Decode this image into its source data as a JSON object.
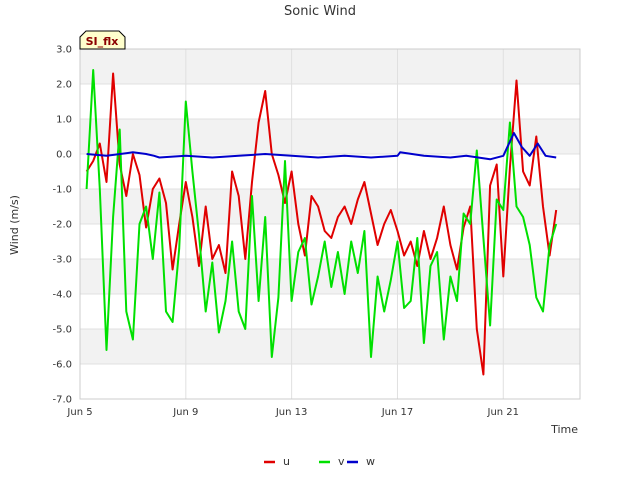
{
  "chart_data": {
    "type": "line",
    "title": "Sonic Wind",
    "badge": "SI_flx",
    "xlabel": "Time",
    "ylabel": "Wind (m/s)",
    "ylim": [
      -7,
      3
    ],
    "yticks": [
      3,
      2,
      1,
      0,
      -1,
      -2,
      -3,
      -4,
      -5,
      -6,
      -7
    ],
    "ytick_labels": [
      "3.0",
      "2.0",
      "1.0",
      "0.0",
      "-1.0",
      "-2.0",
      "-3.0",
      "-4.0",
      "-5.0",
      "-6.0",
      "-7.0"
    ],
    "xlim": [
      5.0,
      23.9
    ],
    "xticks": [
      5,
      9,
      13,
      17,
      21
    ],
    "xtick_labels": [
      "Jun 5",
      "Jun 9",
      "Jun 13",
      "Jun 17",
      "Jun 21"
    ],
    "grid": true,
    "legend_position": "bottom",
    "series": [
      {
        "name": "u",
        "color": "#e00000",
        "x": [
          5.25,
          5.5,
          5.75,
          6.0,
          6.25,
          6.5,
          6.75,
          7.0,
          7.25,
          7.5,
          7.75,
          8.0,
          8.25,
          8.5,
          8.75,
          9.0,
          9.25,
          9.5,
          9.75,
          10.0,
          10.25,
          10.5,
          10.75,
          11.0,
          11.25,
          11.5,
          11.75,
          12.0,
          12.25,
          12.5,
          12.75,
          13.0,
          13.25,
          13.5,
          13.75,
          14.0,
          14.25,
          14.5,
          14.75,
          15.0,
          15.25,
          15.5,
          15.75,
          16.0,
          16.25,
          16.5,
          16.75,
          17.0,
          17.25,
          17.5,
          17.75,
          18.0,
          18.25,
          18.5,
          18.75,
          19.0,
          19.25,
          19.5,
          19.75,
          20.0,
          20.25,
          20.5,
          20.75,
          21.0,
          21.25,
          21.5,
          21.75,
          22.0,
          22.25,
          22.5,
          22.75,
          23.0
        ],
        "y": [
          -0.5,
          -0.2,
          0.3,
          -0.8,
          2.3,
          -0.3,
          -1.2,
          0.0,
          -0.6,
          -2.1,
          -1.0,
          -0.7,
          -1.4,
          -3.3,
          -2.0,
          -0.8,
          -1.8,
          -3.2,
          -1.5,
          -3.0,
          -2.6,
          -3.4,
          -0.5,
          -1.2,
          -3.0,
          -0.8,
          0.9,
          1.8,
          0.0,
          -0.6,
          -1.4,
          -0.5,
          -2.0,
          -2.9,
          -1.2,
          -1.5,
          -2.2,
          -2.4,
          -1.8,
          -1.5,
          -2.0,
          -1.3,
          -0.8,
          -1.7,
          -2.6,
          -2.0,
          -1.6,
          -2.2,
          -2.9,
          -2.5,
          -3.2,
          -2.2,
          -3.0,
          -2.4,
          -1.5,
          -2.6,
          -3.3,
          -2.1,
          -1.5,
          -5.0,
          -6.3,
          -0.9,
          -0.3,
          -3.5,
          -0.4,
          2.1,
          -0.5,
          -0.9,
          0.5,
          -1.5,
          -2.9,
          -1.6
        ]
      },
      {
        "name": "v",
        "color": "#00e000",
        "x": [
          5.25,
          5.5,
          5.75,
          6.0,
          6.25,
          6.5,
          6.75,
          7.0,
          7.25,
          7.5,
          7.75,
          8.0,
          8.25,
          8.5,
          8.75,
          9.0,
          9.25,
          9.5,
          9.75,
          10.0,
          10.25,
          10.5,
          10.75,
          11.0,
          11.25,
          11.5,
          11.75,
          12.0,
          12.25,
          12.5,
          12.75,
          13.0,
          13.25,
          13.5,
          13.75,
          14.0,
          14.25,
          14.5,
          14.75,
          15.0,
          15.25,
          15.5,
          15.75,
          16.0,
          16.25,
          16.5,
          16.75,
          17.0,
          17.25,
          17.5,
          17.75,
          18.0,
          18.25,
          18.5,
          18.75,
          19.0,
          19.25,
          19.5,
          19.75,
          20.0,
          20.25,
          20.5,
          20.75,
          21.0,
          21.25,
          21.5,
          21.75,
          22.0,
          22.25,
          22.5,
          22.75,
          23.0
        ],
        "y": [
          -1.0,
          2.4,
          -1.0,
          -5.6,
          -1.8,
          0.7,
          -4.5,
          -5.3,
          -2.0,
          -1.5,
          -3.0,
          -1.1,
          -4.5,
          -4.8,
          -2.7,
          1.5,
          -0.5,
          -2.3,
          -4.5,
          -3.1,
          -5.1,
          -4.2,
          -2.5,
          -4.5,
          -5.0,
          -1.2,
          -4.2,
          -1.8,
          -5.8,
          -4.1,
          -0.2,
          -4.2,
          -2.8,
          -2.4,
          -4.3,
          -3.5,
          -2.5,
          -3.8,
          -2.8,
          -4.0,
          -2.5,
          -3.4,
          -2.2,
          -5.8,
          -3.5,
          -4.5,
          -3.6,
          -2.5,
          -4.4,
          -4.2,
          -2.4,
          -5.4,
          -3.2,
          -2.8,
          -5.3,
          -3.5,
          -4.2,
          -1.7,
          -2.0,
          0.1,
          -2.4,
          -4.9,
          -1.3,
          -1.6,
          0.9,
          -1.5,
          -1.8,
          -2.6,
          -4.1,
          -4.5,
          -2.6,
          -2.0
        ]
      },
      {
        "name": "w",
        "color": "#0000cc",
        "x": [
          5.25,
          6.0,
          7.0,
          7.5,
          7.8,
          8.0,
          9.0,
          10.0,
          11.0,
          12.0,
          13.0,
          14.0,
          15.0,
          16.0,
          17.0,
          17.1,
          18.0,
          19.0,
          19.6,
          20.5,
          21.0,
          21.4,
          21.7,
          22.0,
          22.3,
          22.6,
          23.0
        ],
        "y": [
          0.0,
          -0.05,
          0.05,
          0.0,
          -0.05,
          -0.1,
          -0.05,
          -0.1,
          -0.05,
          0.0,
          -0.05,
          -0.1,
          -0.05,
          -0.1,
          -0.05,
          0.05,
          -0.05,
          -0.1,
          -0.05,
          -0.15,
          -0.05,
          0.6,
          0.2,
          -0.05,
          0.3,
          -0.05,
          -0.1
        ]
      }
    ]
  }
}
